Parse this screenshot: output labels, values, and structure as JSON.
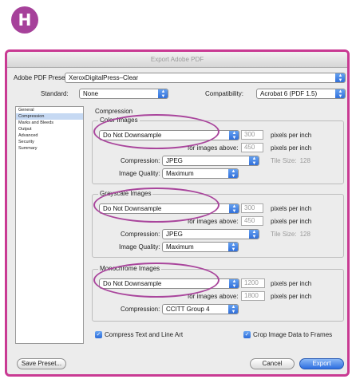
{
  "badge": "H",
  "window_title": "Export Adobe PDF",
  "preset": {
    "label": "Adobe PDF Preset:",
    "value": "XeroxDigitalPress–Clear"
  },
  "standard": {
    "label": "Standard:",
    "value": "None"
  },
  "compatibility": {
    "label": "Compatibility:",
    "value": "Acrobat 6 (PDF 1.5)"
  },
  "sidebar": {
    "items": [
      "General",
      "Compression",
      "Marks and Bleeds",
      "Output",
      "Advanced",
      "Security",
      "Summary"
    ],
    "selected_index": 1
  },
  "section_title": "Compression",
  "color": {
    "title": "Color Images",
    "sampling": "Do Not Downsample",
    "ppi_value": "300",
    "ppi_unit": "pixels per inch",
    "above_label": "for images above:",
    "above_value": "450",
    "above_unit": "pixels per inch",
    "compression_label": "Compression:",
    "compression_value": "JPEG",
    "tile_label": "Tile Size:",
    "tile_value": "128",
    "quality_label": "Image Quality:",
    "quality_value": "Maximum"
  },
  "grayscale": {
    "title": "Grayscale Images",
    "sampling": "Do Not Downsample",
    "ppi_value": "300",
    "ppi_unit": "pixels per inch",
    "above_label": "for images above:",
    "above_value": "450",
    "above_unit": "pixels per inch",
    "compression_label": "Compression:",
    "compression_value": "JPEG",
    "tile_label": "Tile Size:",
    "tile_value": "128",
    "quality_label": "Image Quality:",
    "quality_value": "Maximum"
  },
  "monochrome": {
    "title": "Monochrome Images",
    "sampling": "Do Not Downsample",
    "ppi_value": "1200",
    "ppi_unit": "pixels per inch",
    "above_label": "for images above:",
    "above_value": "1800",
    "above_unit": "pixels per inch",
    "compression_label": "Compression:",
    "compression_value": "CCITT Group 4"
  },
  "checkboxes": {
    "compress_text": "Compress Text and Line Art",
    "crop_image": "Crop Image Data to Frames"
  },
  "buttons": {
    "save_preset": "Save Preset...",
    "cancel": "Cancel",
    "export": "Export"
  },
  "colors": {
    "highlight_ring": "#a9459c",
    "window_border": "#c93a93",
    "accent_blue": "#2c6bd8"
  }
}
